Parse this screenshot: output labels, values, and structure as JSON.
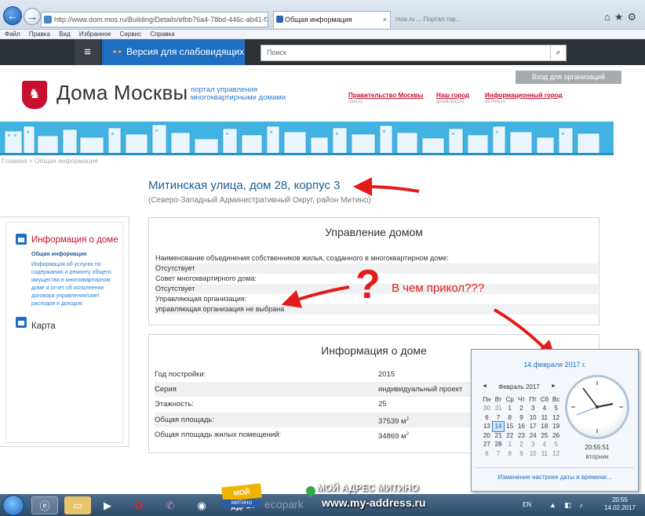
{
  "browser": {
    "url": "http://www.dom.mos.ru/Building/Details/efbb76a4-78bd-446c-ab41-f31",
    "tab_title": "Общая информация",
    "tab_close": "×",
    "tab2_title": "mos.ru ... Портал гор...",
    "menu": [
      "Файл",
      "Правка",
      "Вид",
      "Избранное",
      "Сервис",
      "Справка"
    ]
  },
  "site": {
    "menu_icon": "≡",
    "vision_label": "Версия для слабовидящих",
    "search_placeholder": "Поиск",
    "org_login": "Вход для организаций",
    "brand": "Дома Москвы",
    "tagline": "портал управления многоквартирными домами",
    "top_links": [
      {
        "label": "Правительство Москвы",
        "sub": "mos.ru"
      },
      {
        "label": "Наш город",
        "sub": "gorod.mos.ru"
      },
      {
        "label": "Информационный город",
        "sub": "dit.mos.ru"
      }
    ],
    "breadcrumb": "Главная > Общая информация"
  },
  "building": {
    "address": "Митинская улица, дом 28, корпус 3",
    "district": "(Северо-Западный Административный Округ, район Митино)"
  },
  "left_nav": {
    "item1": "Информация о доме",
    "sub_title": "Общая информация",
    "sub_text": "Информация об услугах по содержанию и ремонту общего имущества в многоквартирном доме и отчет об исполнении договора управления/смет расходов и доходов",
    "item2": "Карта"
  },
  "management": {
    "title": "Управление домом",
    "rows": [
      "Наименование объединения собственников жилья, созданного в многоквартирном доме:",
      "Отсутствует",
      "Совет многоквартирного дома:",
      "Отсутствует",
      "Управляющая организация:",
      "управляющая организация не выбрана"
    ]
  },
  "house_info": {
    "title": "Информация о доме",
    "rows": [
      {
        "label": "Год постройки:",
        "value": "2015"
      },
      {
        "label": "Серия",
        "value": "индивидуальный проект"
      },
      {
        "label": "Этажность:",
        "value": "25"
      },
      {
        "label": "Общая площадь:",
        "value": "37539 м",
        "unit_sup": "2"
      },
      {
        "label": "Общая площадь жилых помещений:",
        "value": "34869 м",
        "unit_sup": "2"
      }
    ]
  },
  "annotation": {
    "note": "В чем прикол???",
    "question": "?"
  },
  "clock_popup": {
    "date": "14 февраля 2017 г.",
    "month": "Февраль 2017",
    "prev": "◄",
    "next": "►",
    "weekdays": [
      "Пн",
      "Вт",
      "Ср",
      "Чт",
      "Пт",
      "Сб",
      "Вс"
    ],
    "weeks": [
      [
        "30",
        "31",
        "1",
        "2",
        "3",
        "4",
        "5"
      ],
      [
        "6",
        "7",
        "8",
        "9",
        "10",
        "11",
        "12"
      ],
      [
        "13",
        "14",
        "15",
        "16",
        "17",
        "18",
        "19"
      ],
      [
        "20",
        "21",
        "22",
        "23",
        "24",
        "25",
        "26"
      ],
      [
        "27",
        "28",
        "1",
        "2",
        "3",
        "4",
        "5"
      ],
      [
        "6",
        "7",
        "8",
        "9",
        "10",
        "11",
        "12"
      ]
    ],
    "today": "14",
    "time": "20:55:51",
    "weekday": "вторник",
    "settings_link": "Изменение настроек даты и времени..."
  },
  "taskbar": {
    "lang": "EN",
    "time": "20:55",
    "date": "14.02.2017",
    "tray_icons": "▲ ◧ ♪"
  },
  "watermark": {
    "badge_top": "МОЙ АДРЕС",
    "badge_bottom": "МИТИНО",
    "ecopark": "ecopark",
    "title": "МОЙ АДРЕС МИТИНО",
    "url": "www.my-address.ru"
  },
  "colors": {
    "accent_blue": "#1e6fc4",
    "brand_red": "#c8102e",
    "annotation_red": "#e31b1b",
    "banner_blue": "#41b3e3"
  }
}
